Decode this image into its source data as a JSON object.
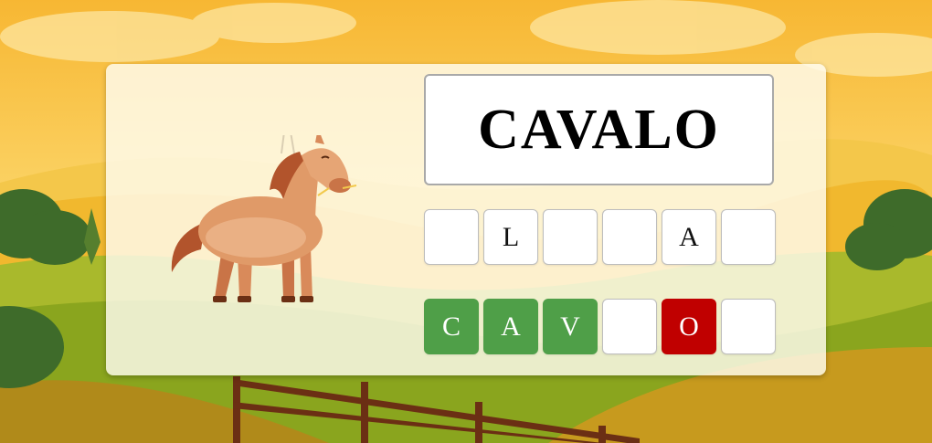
{
  "target_word": "CAVALO",
  "hint_tiles": [
    "",
    "L",
    "",
    "",
    "A",
    ""
  ],
  "answer_tiles": [
    {
      "letter": "C",
      "state": "correct"
    },
    {
      "letter": "A",
      "state": "correct"
    },
    {
      "letter": "V",
      "state": "correct"
    },
    {
      "letter": "",
      "state": "empty"
    },
    {
      "letter": "O",
      "state": "wrong"
    },
    {
      "letter": "",
      "state": "empty"
    }
  ],
  "picture": "horse",
  "colors": {
    "correct": "#4f9f48",
    "wrong": "#c00000",
    "sky": "#f7c84a",
    "grass": "#8aa51e"
  }
}
